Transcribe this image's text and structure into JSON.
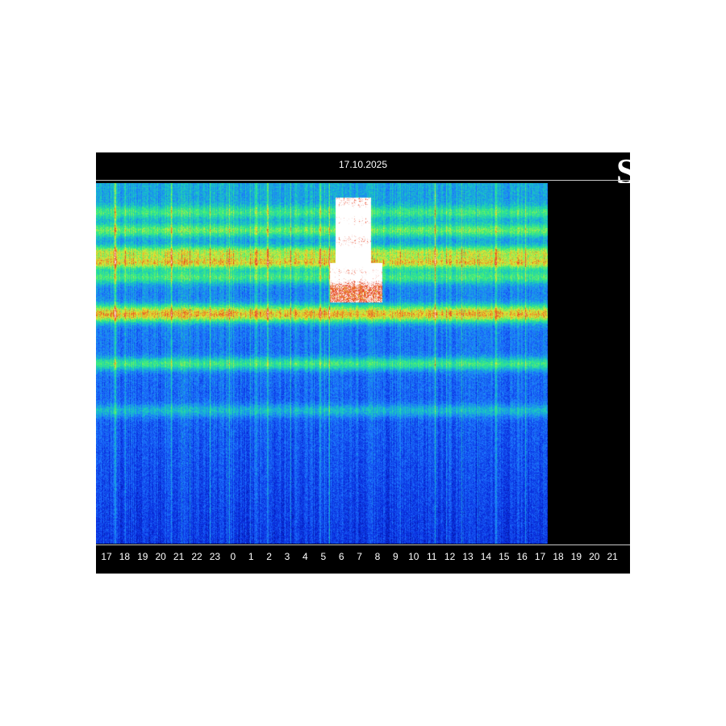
{
  "chart_data": {
    "type": "heatmap",
    "title": "17.10.2025",
    "xlabel": "",
    "ylabel": "",
    "x_tick_labels": [
      "17",
      "18",
      "19",
      "20",
      "21",
      "22",
      "23",
      "0",
      "1",
      "2",
      "3",
      "4",
      "5",
      "6",
      "7",
      "8",
      "9",
      "10",
      "11",
      "12",
      "13",
      "14",
      "15",
      "16",
      "17",
      "18",
      "19",
      "20",
      "21"
    ],
    "data_coverage_hours": [
      0,
      24
    ],
    "colormap": [
      "#000a8c",
      "#0a2ee0",
      "#1e78ff",
      "#17c3c8",
      "#3cf07a",
      "#e6e632",
      "#e63c1e",
      "#ffffff"
    ],
    "horizontal_bands": [
      {
        "level": 0.08,
        "intensity": 0.45
      },
      {
        "level": 0.13,
        "intensity": 0.6
      },
      {
        "level": 0.19,
        "intensity": 0.75
      },
      {
        "level": 0.22,
        "intensity": 0.9
      },
      {
        "level": 0.26,
        "intensity": 0.55
      },
      {
        "level": 0.35,
        "intensity": 0.65
      },
      {
        "level": 0.37,
        "intensity": 0.8
      },
      {
        "level": 0.5,
        "intensity": 0.65
      },
      {
        "level": 0.63,
        "intensity": 0.4
      }
    ],
    "vertical_events": [
      {
        "hour": 1.0,
        "intensity": 0.7
      },
      {
        "hour": 4.0,
        "intensity": 0.6
      },
      {
        "hour": 8.5,
        "intensity": 0.45
      },
      {
        "hour": 9.1,
        "intensity": 0.5
      },
      {
        "hour": 11.9,
        "intensity": 0.55
      },
      {
        "hour": 18.0,
        "intensity": 0.45
      }
    ],
    "bursts": [
      {
        "hour_start": 12.7,
        "hour_end": 14.6,
        "level_start": 0.04,
        "level_end": 0.22,
        "intensity": 1.0
      },
      {
        "hour_start": 12.4,
        "hour_end": 15.2,
        "level_start": 0.22,
        "level_end": 0.33,
        "intensity": 0.85
      }
    ]
  }
}
